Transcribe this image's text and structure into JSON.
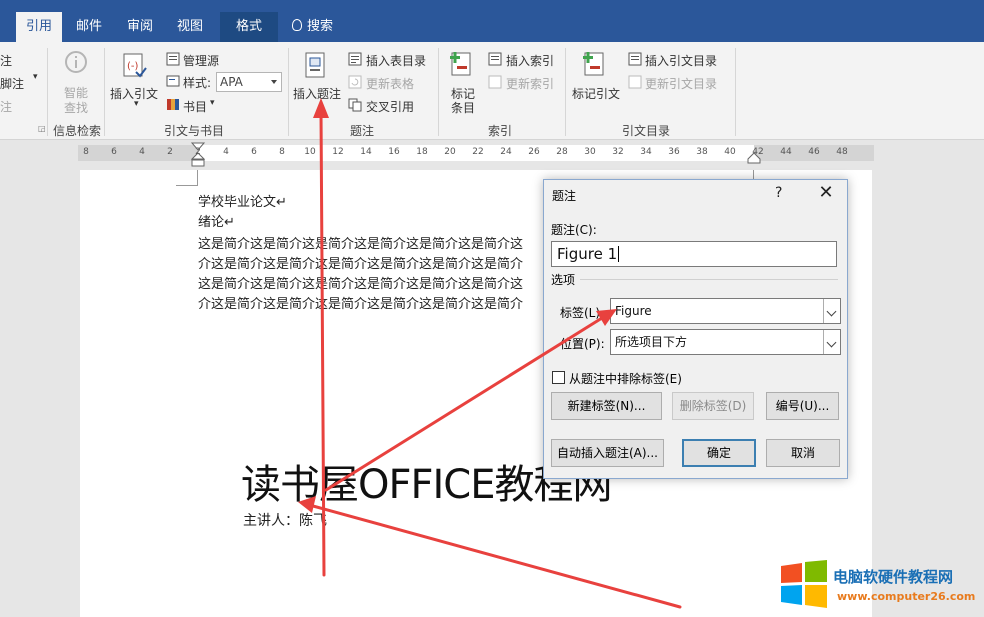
{
  "tabs": [
    "引用",
    "邮件",
    "审阅",
    "视图",
    "格式"
  ],
  "search_label": "搜索",
  "ribbon": {
    "left_partial": [
      "注",
      "脚注",
      "注"
    ],
    "smart_lookup": [
      "智能",
      "查找"
    ],
    "insert_citation": "插入引文",
    "manage_sources": "管理源",
    "style_label": "样式:",
    "style_value": "APA",
    "bibliography": "书目",
    "insert_caption": "插入题注",
    "insert_table_of_figures": "插入表目录",
    "update_table": "更新表格",
    "cross_reference": "交叉引用",
    "mark_entry": [
      "标记",
      "条目"
    ],
    "insert_index": "插入索引",
    "update_index": "更新索引",
    "mark_citation": "标记引文",
    "insert_table_of_authorities": "插入引文目录",
    "update_table_of_authorities": "更新引文目录",
    "groups": [
      "信息检索",
      "引文与书目",
      "题注",
      "索引",
      "引文目录"
    ]
  },
  "ruler_numbers": [
    "8",
    "6",
    "4",
    "2",
    "2",
    "4",
    "6",
    "8",
    "10",
    "12",
    "14",
    "16",
    "18",
    "20",
    "22",
    "24",
    "26",
    "28",
    "30",
    "32",
    "34",
    "36",
    "38",
    "40",
    "42",
    "44",
    "46",
    "48"
  ],
  "document": {
    "line1": "学校毕业论文↵",
    "line2": "绪论↵",
    "body": [
      "这是简介这是简介这是简介这是简介这是简介这是简介这",
      "介这是简介这是简介这是简介这是简介这是简介这是简介",
      "这是简介这是简介这是简介这是简介这是简介这是简介这",
      "介这是简介这是简介这是简介这是简介这是简介这是简介"
    ],
    "title": "读书屋OFFICE教程网",
    "speaker": "主讲人：陈飞"
  },
  "dialog": {
    "title": "题注",
    "help": "?",
    "close": "✕",
    "caption_label": "题注(C):",
    "caption_value": "Figure 1",
    "options_label": "选项",
    "label_label": "标签(L):",
    "label_value": "Figure",
    "position_label": "位置(P):",
    "position_value": "所选项目下方",
    "exclude_label": "从题注中排除标签(E)",
    "new_label_btn": "新建标签(N)...",
    "delete_label_btn": "删除标签(D)",
    "numbering_btn": "编号(U)...",
    "autocaption_btn": "自动插入题注(A)...",
    "ok_btn": "确定",
    "cancel_btn": "取消"
  },
  "watermark": {
    "title": "电脑软硬件教程网",
    "url": "www.computer26.com"
  },
  "colors": {
    "ribbon_blue": "#2b579a",
    "arrow_red": "#e8413e"
  }
}
